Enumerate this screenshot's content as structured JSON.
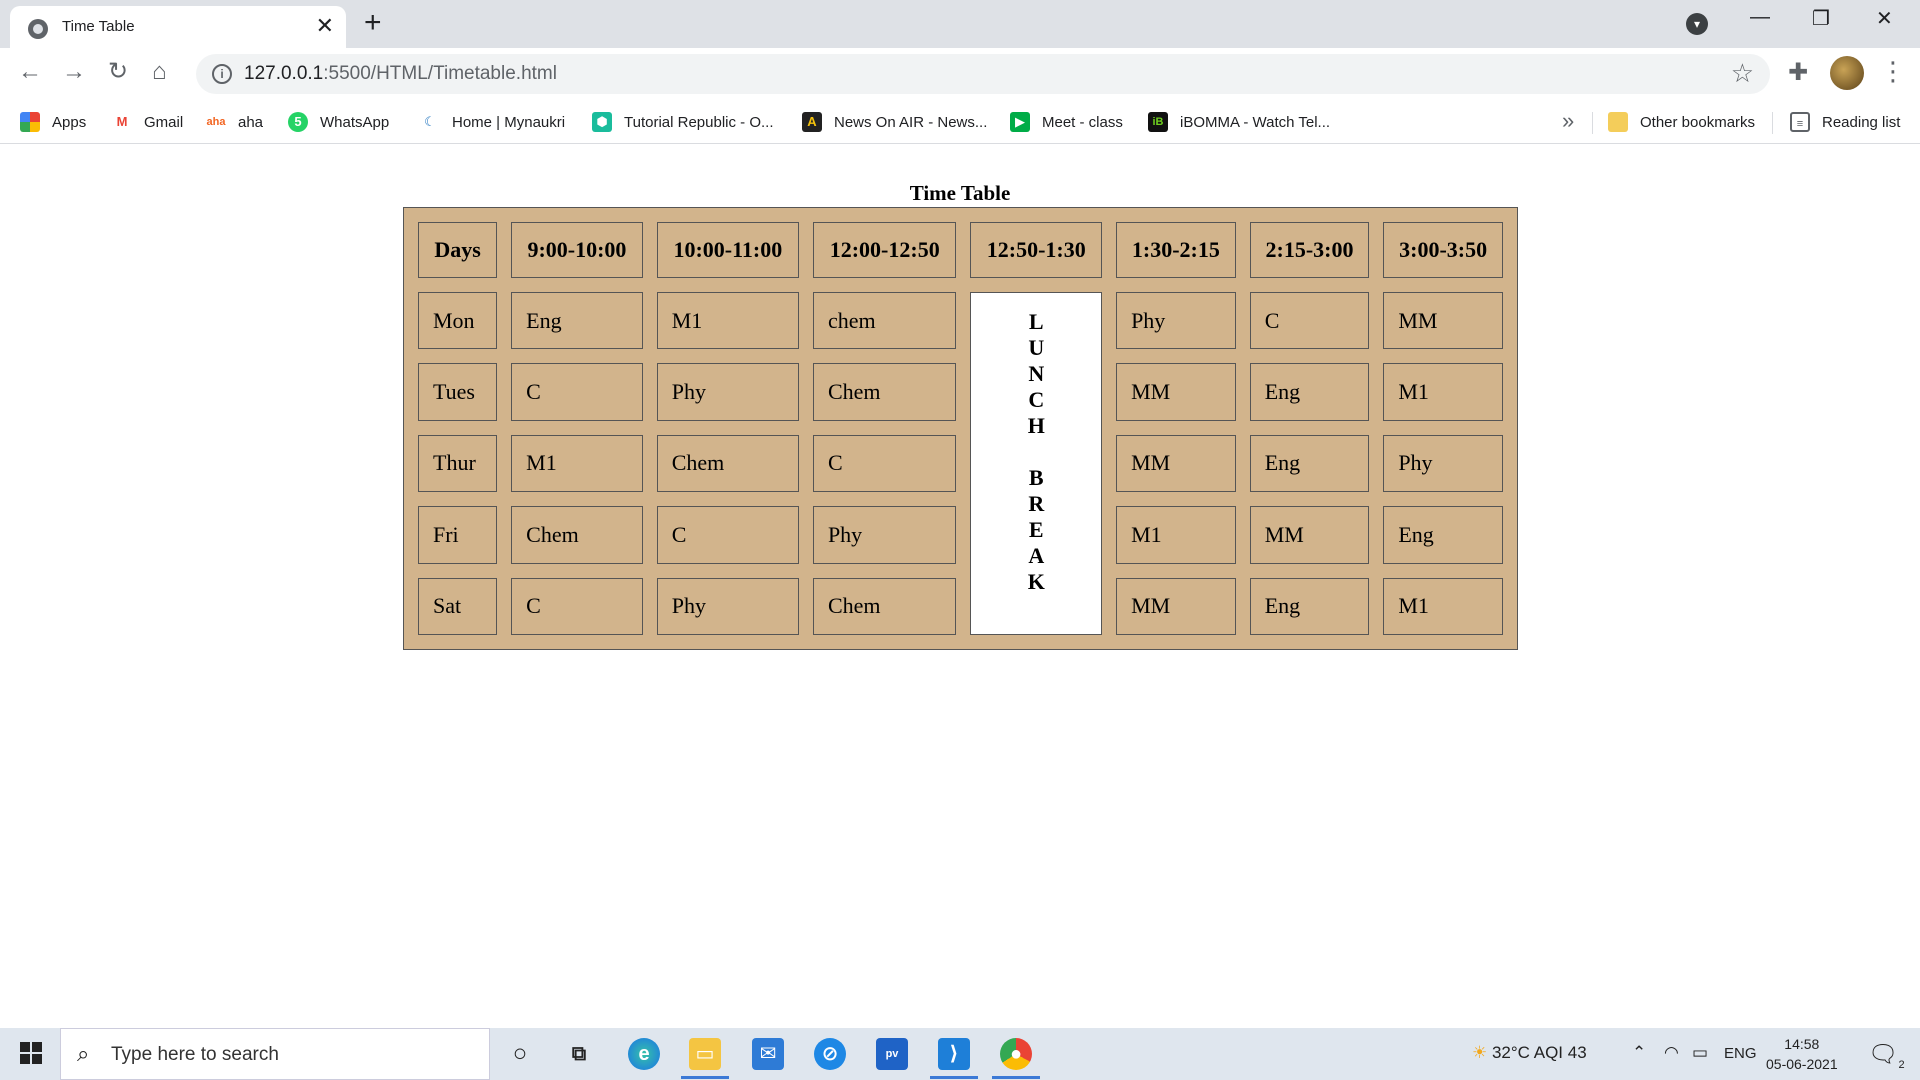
{
  "browser": {
    "tab_title": "Time Table",
    "tab_close": "✕",
    "new_tab": "+",
    "url_host": "127.0.0.1",
    "url_rest": ":5500/HTML/Timetable.html",
    "window_controls": {
      "minimize": "—",
      "maximize": "❐",
      "close": "✕"
    },
    "bookmarks": [
      {
        "label": "Apps",
        "icon": "apps-grid-icon"
      },
      {
        "label": "Gmail",
        "icon": "gmail-icon"
      },
      {
        "label": "aha",
        "icon": "aha-icon"
      },
      {
        "label": "WhatsApp",
        "icon": "whatsapp-icon"
      },
      {
        "label": "Home | Mynaukri",
        "icon": "mynaukri-icon"
      },
      {
        "label": "Tutorial Republic - O...",
        "icon": "tutorial-republic-icon"
      },
      {
        "label": "News On AIR - News...",
        "icon": "news-on-air-icon"
      },
      {
        "label": "Meet - class",
        "icon": "meet-icon"
      },
      {
        "label": "iBOMMA - Watch Tel...",
        "icon": "ibomma-icon"
      }
    ],
    "bookmarks_more": "»",
    "other_bookmarks": "Other bookmarks",
    "reading_list": "Reading list"
  },
  "page": {
    "caption": "Time Table",
    "headers": [
      "Days",
      "9:00-10:00",
      "10:00-11:00",
      "12:00-12:50",
      "12:50-1:30",
      "1:30-2:15",
      "2:15-3:00",
      "3:00-3:50"
    ],
    "rows": [
      {
        "day": "Mon",
        "before": [
          "Eng",
          "M1",
          "chem"
        ],
        "after": [
          "Phy",
          "C",
          "MM"
        ]
      },
      {
        "day": "Tues",
        "before": [
          "C",
          "Phy",
          "Chem"
        ],
        "after": [
          "MM",
          "Eng",
          "M1"
        ]
      },
      {
        "day": "Thur",
        "before": [
          "M1",
          "Chem",
          "C"
        ],
        "after": [
          "MM",
          "Eng",
          "Phy"
        ]
      },
      {
        "day": "Fri",
        "before": [
          "Chem",
          "C",
          "Phy"
        ],
        "after": [
          "M1",
          "MM",
          "Eng"
        ]
      },
      {
        "day": "Sat",
        "before": [
          "C",
          "Phy",
          "Chem"
        ],
        "after": [
          "MM",
          "Eng",
          "M1"
        ]
      }
    ],
    "lunch_letters": [
      "L",
      "U",
      "N",
      "C",
      "H",
      "",
      "B",
      "R",
      "E",
      "A",
      "K"
    ]
  },
  "taskbar": {
    "search_placeholder": "Type here to search",
    "weather": "32°C  AQI 43",
    "language": "ENG",
    "time": "14:58",
    "date": "05-06-2021",
    "notification_count": "2"
  }
}
